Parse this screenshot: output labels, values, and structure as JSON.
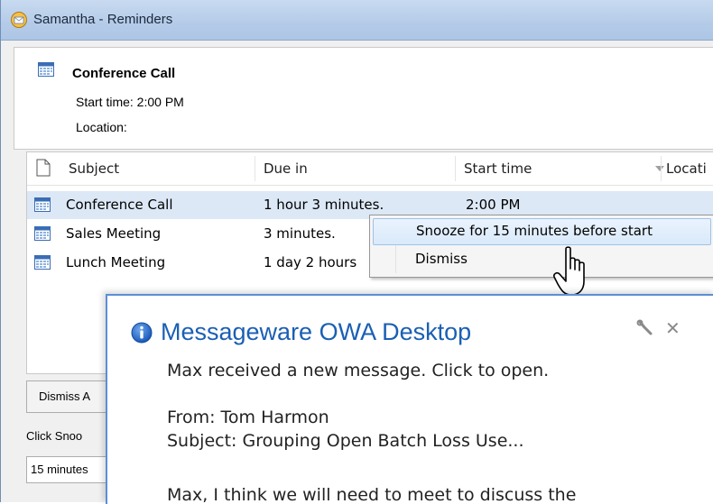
{
  "window": {
    "title": "Samantha - Reminders"
  },
  "reminder": {
    "subject": "Conference Call",
    "start_time": "Start time:  2:00 PM",
    "location": "Location:"
  },
  "list": {
    "headers": [
      "Subject",
      "Due in",
      "Start time",
      "Locati"
    ],
    "rows": [
      {
        "subject": "Conference Call",
        "due": "1 hour 3 minutes.",
        "start": "2:00 PM",
        "selected": true
      },
      {
        "subject": "Sales Meeting",
        "due": "3 minutes.",
        "start": "",
        "selected": false
      },
      {
        "subject": "Lunch Meeting",
        "due": "1 day 2 hours",
        "start": "",
        "selected": false
      }
    ]
  },
  "context_menu": {
    "items": [
      "Snooze for 15 minutes before start",
      "Dismiss"
    ]
  },
  "bottom": {
    "dismiss_all": "Dismiss A",
    "click_text": "Click Snoo",
    "snooze_value": "15 minutes"
  },
  "toast": {
    "title": "Messageware OWA Desktop",
    "message": "Max received a new message. Click to open.",
    "from": "From: Tom Harmon",
    "subject": "Subject: Grouping Open Batch Loss Use...",
    "body": "Max, I think we will need to meet to discuss the"
  },
  "colors": {
    "titlebar": "#b4cbe8",
    "selection": "#dce8f6",
    "toast_border": "#5b8ed6",
    "toast_title": "#1a5fb4"
  },
  "icons": [
    "reminder-app-icon",
    "calendar-icon",
    "document-icon",
    "info-icon",
    "wrench-icon",
    "close-icon",
    "hand-cursor-icon"
  ]
}
